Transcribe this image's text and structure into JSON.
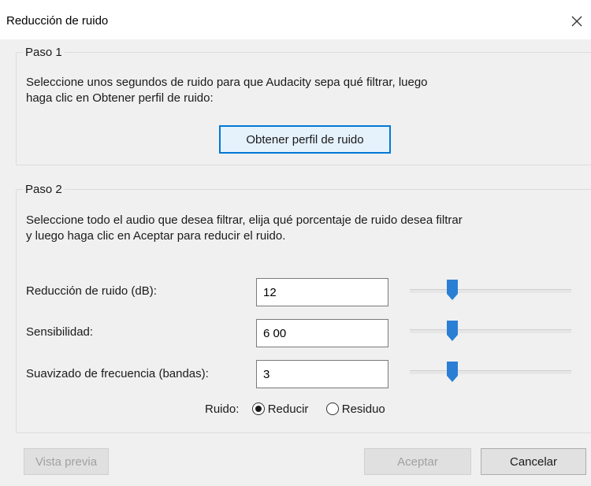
{
  "window": {
    "title": "Reducción de ruido"
  },
  "step1": {
    "legend": "Paso 1",
    "desc_line1": "Seleccione unos segundos de ruido para que Audacity sepa qué filtrar, luego",
    "desc_line2": "haga clic en Obtener perfil de ruido:",
    "profile_button": "Obtener perfil de ruido"
  },
  "step2": {
    "legend": "Paso 2",
    "desc_line1": "Seleccione todo el audio que desea filtrar, elija qué porcentaje de ruido desea filtrar",
    "desc_line2": "y luego haga clic en Aceptar para reducir el ruido.",
    "params": [
      {
        "label": "Reducción de ruido (dB):",
        "value": "12"
      },
      {
        "label": "Sensibilidad:",
        "value": "6 00"
      },
      {
        "label": "Suavizado de frecuencia (bandas):",
        "value": "3"
      }
    ],
    "noise_label": "Ruido:",
    "radio_options": [
      {
        "label": "Reducir",
        "checked": true
      },
      {
        "label": "Residuo",
        "checked": false
      }
    ]
  },
  "footer": {
    "preview_button": "Vista previa",
    "ok_button": "Aceptar",
    "cancel_button": "Cancelar"
  },
  "icons": {
    "close": "close-icon"
  },
  "colors": {
    "accent": "#0078d7",
    "slider_thumb": "#2a7fd4"
  }
}
